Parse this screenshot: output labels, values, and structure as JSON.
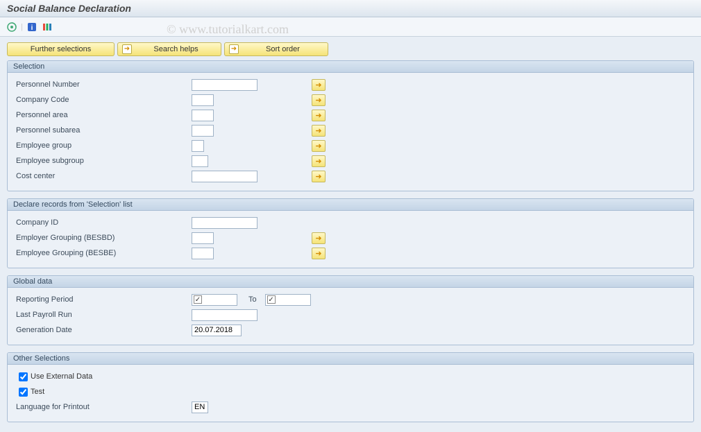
{
  "title": "Social Balance Declaration",
  "watermark": "© www.tutorialkart.com",
  "toolbar_icons": [
    "execute",
    "info",
    "variant"
  ],
  "top_buttons": {
    "further_selections": "Further selections",
    "search_helps": "Search helps",
    "sort_order": "Sort order"
  },
  "groups": {
    "selection": {
      "title": "Selection",
      "fields": {
        "personnel_number": {
          "label": "Personnel Number",
          "value": "",
          "has_more": true
        },
        "company_code": {
          "label": "Company Code",
          "value": "",
          "has_more": true
        },
        "personnel_area": {
          "label": "Personnel area",
          "value": "",
          "has_more": true
        },
        "personnel_subarea": {
          "label": "Personnel subarea",
          "value": "",
          "has_more": true
        },
        "employee_group": {
          "label": "Employee group",
          "value": "",
          "has_more": true
        },
        "employee_subgroup": {
          "label": "Employee subgroup",
          "value": "",
          "has_more": true
        },
        "cost_center": {
          "label": "Cost center",
          "value": "",
          "has_more": true
        }
      }
    },
    "declare": {
      "title": "Declare records from 'Selection' list",
      "fields": {
        "company_id": {
          "label": "Company ID",
          "value": "",
          "has_more": false
        },
        "employer_grouping": {
          "label": "Employer Grouping (BESBD)",
          "value": "",
          "has_more": true
        },
        "employee_grouping": {
          "label": "Employee Grouping (BESBE)",
          "value": "",
          "has_more": true
        }
      }
    },
    "global_data": {
      "title": "Global data",
      "reporting_period": {
        "label": "Reporting Period",
        "from_checked": true,
        "from_value": "",
        "to_label": "To",
        "to_checked": true,
        "to_value": ""
      },
      "last_payroll_run": {
        "label": "Last Payroll Run",
        "value": ""
      },
      "generation_date": {
        "label": "Generation Date",
        "value": "20.07.2018"
      }
    },
    "other": {
      "title": "Other Selections",
      "use_external_data": {
        "label": "Use External Data",
        "checked": true
      },
      "test": {
        "label": "Test",
        "checked": true
      },
      "language": {
        "label": "Language for Printout",
        "value": "EN"
      }
    }
  }
}
